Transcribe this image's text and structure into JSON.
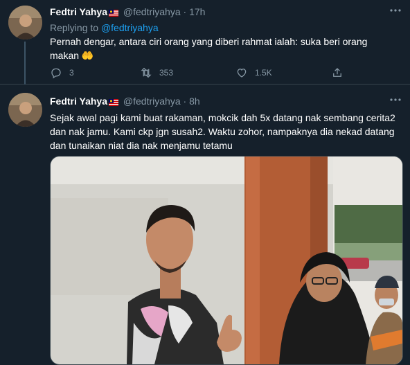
{
  "tweets": [
    {
      "display_name": "Fedtri Yahya",
      "handle": "@fedtriyahya",
      "separator": "·",
      "time": "17h",
      "replying_label": "Replying to",
      "replying_handle": "@fedtriyahya",
      "text": "Pernah dengar, antara ciri orang yang diberi rahmat ialah: suka beri orang makan 🤲",
      "actions": {
        "replies": "3",
        "retweets": "353",
        "likes": "1.5K"
      }
    },
    {
      "display_name": "Fedtri Yahya",
      "handle": "@fedtriyahya",
      "separator": "·",
      "time": "8h",
      "text": "Sejak awal pagi kami buat rakaman, mokcik dah 5x datang nak sembang cerita2 dan nak jamu. Kami ckp jgn susah2. Waktu zohor, nampaknya dia nekad datang dan tunaikan niat dia nak menjamu tetamu"
    }
  ],
  "icons": {
    "more": "more-icon",
    "reply": "reply-icon",
    "retweet": "retweet-icon",
    "like": "heart-icon",
    "share": "share-icon",
    "flag": "malaysia-flag-icon"
  },
  "colors": {
    "background": "#15202b",
    "border": "#38444d",
    "muted": "#8899a6",
    "link": "#1da1f2"
  }
}
